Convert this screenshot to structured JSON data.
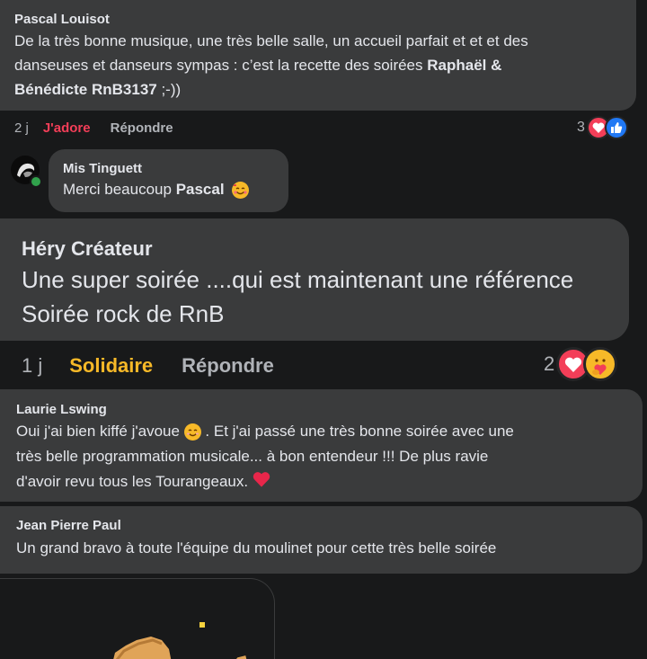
{
  "comments": [
    {
      "name": "Pascal Louisot",
      "text_line1": "De la très bonne musique, une très belle salle, un accueil parfait et et et des",
      "text_line2": "danseuses et danseurs sympas : c’est la recette des soirées ",
      "text_bold1": "Raphaël &",
      "text_bold2": "Bénédicte RnB3137",
      "text_tail": " ;-))",
      "time": "2 j",
      "reaction_label": "J'adore",
      "reply_label": "Répondre",
      "reaction_count": "3",
      "reaction_color": "#f33e58"
    },
    {
      "name": "Mis Tinguett",
      "text_prefix": "Merci beaucoup ",
      "text_bold": "Pascal",
      "emoji": "smiling-face-with-hearts"
    },
    {
      "name": "Héry Créateur",
      "text_line1": "Une super soirée ....qui est maintenant une référence",
      "text_line2": "Soirée rock de RnB",
      "time": "1 j",
      "reaction_label": "Solidaire",
      "reply_label": "Répondre",
      "reaction_count": "2",
      "reaction_color": "#f7b928"
    },
    {
      "name": "Laurie Lswing",
      "text_line1a": "Oui j'ai bien kiffé j'avoue ",
      "text_line1b": " . Et j'ai passé une très bonne soirée avec une",
      "text_line2": "très belle programmation musicale... à bon entendeur !!! De plus ravie",
      "text_line3": "d'avoir revu tous les Tourangeaux. "
    },
    {
      "name": "Jean Pierre Paul",
      "text": "Un grand bravo à toute l'équipe du moulinet pour cette très belle soirée"
    }
  ],
  "colors": {
    "background": "#18191a",
    "bubble": "#3a3b3c",
    "love": "#f33e58",
    "like": "#2078f4",
    "care": "#f7b928"
  }
}
